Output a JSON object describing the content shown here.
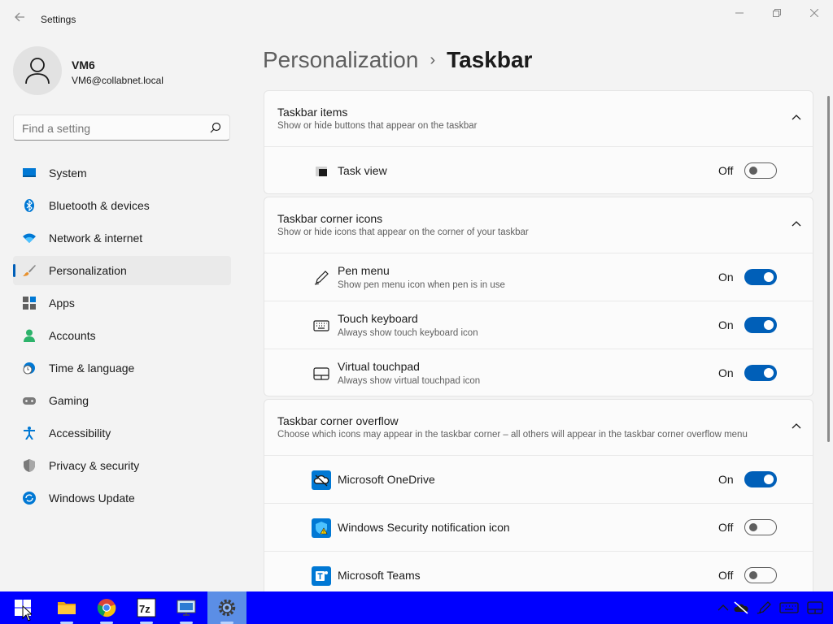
{
  "window": {
    "title": "Settings",
    "back_icon": "back-arrow-icon",
    "controls": [
      "minimize-icon",
      "maximize-icon",
      "close-icon"
    ]
  },
  "profile": {
    "name": "VM6",
    "email": "VM6@collabnet.local",
    "avatar_icon": "user-icon"
  },
  "search": {
    "placeholder": "Find a setting",
    "icon": "search-icon"
  },
  "nav": {
    "items": [
      {
        "label": "System",
        "icon": "system-icon"
      },
      {
        "label": "Bluetooth & devices",
        "icon": "bluetooth-icon"
      },
      {
        "label": "Network & internet",
        "icon": "wifi-icon"
      },
      {
        "label": "Personalization",
        "icon": "brush-icon",
        "active": true
      },
      {
        "label": "Apps",
        "icon": "apps-icon"
      },
      {
        "label": "Accounts",
        "icon": "accounts-icon"
      },
      {
        "label": "Time & language",
        "icon": "clock-globe-icon"
      },
      {
        "label": "Gaming",
        "icon": "gamepad-icon"
      },
      {
        "label": "Accessibility",
        "icon": "accessibility-icon"
      },
      {
        "label": "Privacy & security",
        "icon": "shield-icon"
      },
      {
        "label": "Windows Update",
        "icon": "update-icon"
      }
    ]
  },
  "breadcrumb": {
    "parent": "Personalization",
    "separator": "›",
    "current": "Taskbar"
  },
  "sections": [
    {
      "title": "Taskbar items",
      "description": "Show or hide buttons that appear on the taskbar",
      "expanded": true,
      "rows": [
        {
          "title": "Task view",
          "icon": "task-view-icon",
          "state_label": "Off",
          "on": false
        }
      ]
    },
    {
      "title": "Taskbar corner icons",
      "description": "Show or hide icons that appear on the corner of your taskbar",
      "expanded": true,
      "rows": [
        {
          "title": "Pen menu",
          "description": "Show pen menu icon when pen is in use",
          "icon": "pen-icon",
          "state_label": "On",
          "on": true
        },
        {
          "title": "Touch keyboard",
          "description": "Always show touch keyboard icon",
          "icon": "keyboard-icon",
          "state_label": "On",
          "on": true
        },
        {
          "title": "Virtual touchpad",
          "description": "Always show virtual touchpad icon",
          "icon": "touchpad-icon",
          "state_label": "On",
          "on": true
        }
      ]
    },
    {
      "title": "Taskbar corner overflow",
      "description": "Choose which icons may appear in the taskbar corner – all others will appear in the taskbar corner overflow menu",
      "expanded": true,
      "rows": [
        {
          "title": "Microsoft OneDrive",
          "icon": "onedrive-icon",
          "state_label": "On",
          "on": true
        },
        {
          "title": "Windows Security notification icon",
          "icon": "windows-security-icon",
          "state_label": "Off",
          "on": false
        },
        {
          "title": "Microsoft Teams",
          "icon": "teams-icon",
          "state_label": "Off",
          "on": false
        }
      ]
    }
  ],
  "taskbar": {
    "color": "#0000ff",
    "apps": [
      {
        "icon": "start-windows-icon"
      },
      {
        "icon": "file-explorer-icon",
        "running": true
      },
      {
        "icon": "chrome-icon",
        "running": true
      },
      {
        "icon": "7zip-icon",
        "running": true
      },
      {
        "icon": "remote-desktop-icon",
        "running": true
      },
      {
        "icon": "settings-gear-icon",
        "running": true,
        "active": true
      }
    ],
    "tray": [
      "chevron-up-icon",
      "onedrive-offline-icon",
      "pen-icon",
      "keyboard-icon",
      "touchpad-icon"
    ]
  },
  "colors": {
    "accent": "#005fb8",
    "background": "#f3f3f3",
    "card": "#fbfbfb"
  }
}
